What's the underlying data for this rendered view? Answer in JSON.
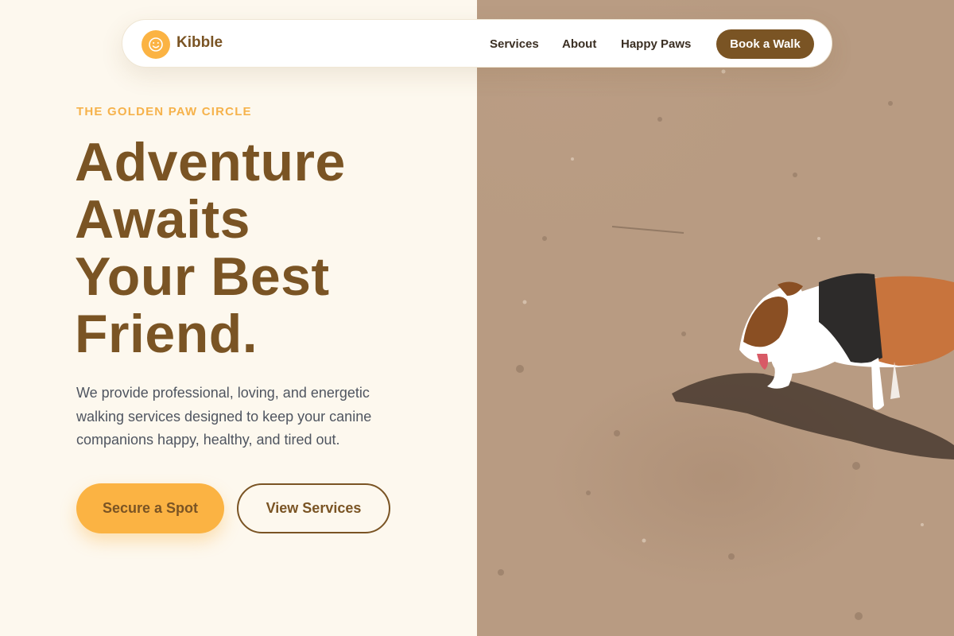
{
  "nav": {
    "brand": "Kibble",
    "logo_icon": "smiley-face-icon",
    "links": [
      "Services",
      "About",
      "Happy Paws"
    ],
    "cta": "Book a Walk"
  },
  "hero": {
    "eyebrow": "THE GOLDEN PAW CIRCLE",
    "headline": [
      "Adventure",
      "Awaits",
      "Your Best",
      "Friend."
    ],
    "description": "We provide professional, loving, and energetic walking services designed to keep your canine companions happy, healthy, and tired out.",
    "primary_button": "Secure a Spot",
    "secondary_button": "View Services"
  },
  "photo": {
    "subject": "dog-walking-photo"
  },
  "colors": {
    "brand_brown": "#7a5424",
    "accent_yellow": "#fbb343",
    "background_cream": "#fdf8ee",
    "body_text": "#4f5560"
  }
}
